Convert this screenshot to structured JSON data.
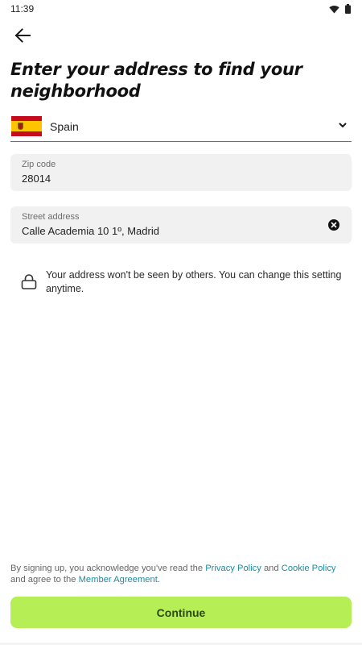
{
  "status_bar": {
    "time": "11:39",
    "icons": [
      "wifi-icon",
      "battery-icon"
    ]
  },
  "header": {
    "back_icon": "arrow-left-icon",
    "title": "Enter your address to find your neighborhood"
  },
  "country": {
    "flag": "spain-flag",
    "name": "Spain",
    "dropdown_icon": "chevron-down-icon"
  },
  "zip_field": {
    "label": "Zip code",
    "value": "28014"
  },
  "street_field": {
    "label": "Street address",
    "value": "Calle Academia 10 1º, Madrid",
    "clear_icon": "clear-icon"
  },
  "privacy_note": {
    "icon": "lock-icon",
    "text": "Your address won't be seen by others. You can change this setting anytime."
  },
  "legal": {
    "prefix": "By signing up, you acknowledge you've read the ",
    "privacy_link": "Privacy Policy",
    "and": " and ",
    "cookie_link": "Cookie Policy",
    "middle": " and agree to the ",
    "member_link": "Member Agreement",
    "suffix": "."
  },
  "continue_button": {
    "label": "Continue"
  },
  "colors": {
    "accent": "#b6ee56",
    "link": "#1a8ea3",
    "field_background": "#f1f1f1"
  }
}
